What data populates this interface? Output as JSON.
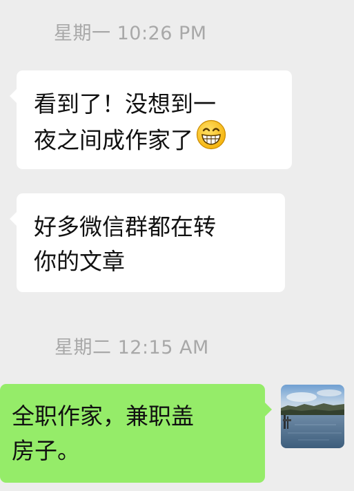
{
  "chat": {
    "timestamp_1": "星期一 10:26 PM",
    "timestamp_2": "星期二 12:15 AM",
    "msg1": {
      "line1": "看到了！没想到一",
      "line2": "夜之间成作家了",
      "emoji": "grinning-face-emoji"
    },
    "msg2": {
      "line1": "好多微信群都在转",
      "line2": "你的文章"
    },
    "msg3": {
      "line1": "全职作家，兼职盖",
      "line2": "房子。"
    },
    "avatar": "lake-photo-avatar"
  },
  "colors": {
    "background": "#ededed",
    "received_bubble": "#ffffff",
    "sent_bubble": "#95ec69",
    "timestamp_text": "#a8a8a8"
  }
}
